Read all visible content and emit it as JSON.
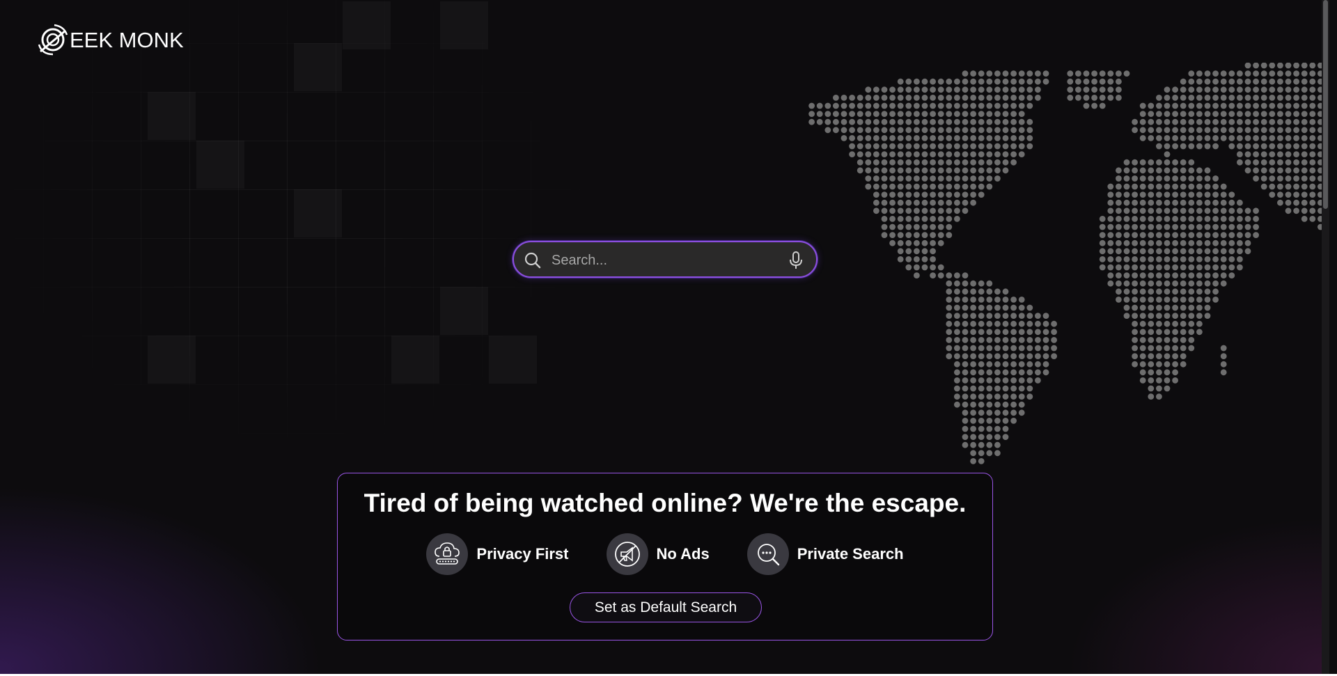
{
  "brand": {
    "name": "EEK MONK",
    "logo_icon": "geek-monk-logo"
  },
  "search": {
    "placeholder": "Search...",
    "left_icon": "search-icon",
    "right_icon": "microphone-icon",
    "accent_color": "#8d4fe0"
  },
  "promo": {
    "title": "Tired of being watched online? We're the escape.",
    "features": [
      {
        "label": "Privacy First",
        "icon": "cloud-lock-icon"
      },
      {
        "label": "No Ads",
        "icon": "no-ads-megaphone-icon"
      },
      {
        "label": "Private Search",
        "icon": "chat-search-icon"
      }
    ],
    "cta_label": "Set as Default Search",
    "border_color": "#9b56e8"
  },
  "background": {
    "base_color": "#0d0c0e",
    "map_dot_color": "#6e6e6e",
    "decoration": "world-map-dots"
  }
}
